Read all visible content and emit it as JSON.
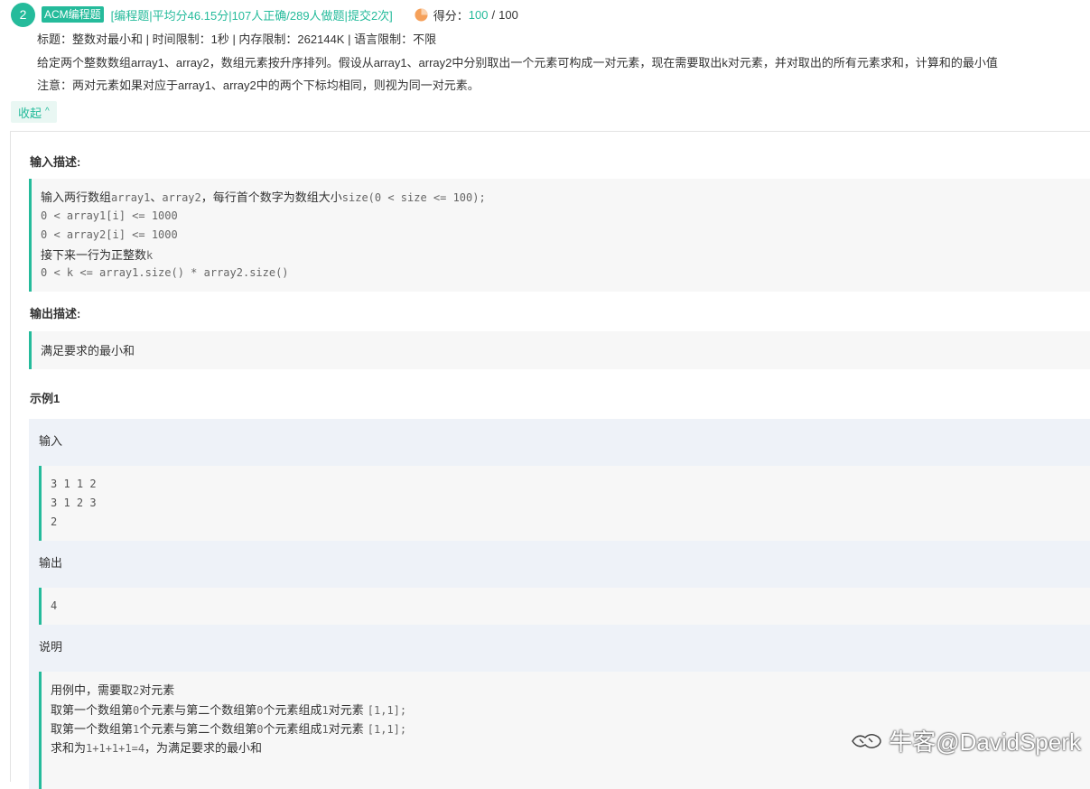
{
  "question": {
    "number": "2",
    "type_tag": "ACM编程题",
    "meta": "[编程题|平均分46.15分|107人正确/289人做题|提交2次]",
    "score_label": "得分：",
    "score_value": "100",
    "score_sep": "/",
    "score_total": "100",
    "title_line": "标题：整数对最小和 | 时间限制：1秒 | 内存限制：262144K | 语言限制：不限",
    "description": "给定两个整数数组array1、array2，数组元素按升序排列。假设从array1、array2中分别取出一个元素可构成一对元素，现在需要取出k对元素，并对取出的所有元素求和，计算和的最小值",
    "note": "注意：两对元素如果对应于array1、array2中的两个下标均相同，则视为同一对元素。",
    "collapse_label": "收起",
    "collapse_icon": "chevron-up-icon"
  },
  "input_desc": {
    "title": "输入描述:",
    "line1_cn": "输入两行数组",
    "line1_code1": "array1",
    "line1_cn2": "、",
    "line1_code2": "array2",
    "line1_cn3": "，每行首个数字为数组大小",
    "line1_code3": "size(0 < size <= 100);",
    "line2": "0 < array1[i] <= 1000",
    "line3": "0 < array2[i] <= 1000",
    "line4_cn": "接下来一行为正整数",
    "line4_code": "k",
    "line5": "0 < k <= array1.size() * array2.size()"
  },
  "output_desc": {
    "title": "输出描述:",
    "text": "满足要求的最小和"
  },
  "example": {
    "title": "示例1",
    "input_label": "输入",
    "input_lines": [
      "3 1 1 2",
      "3 1 2 3",
      "2"
    ],
    "output_label": "输出",
    "output_value": "4",
    "explain_label": "说明",
    "explain_line1_cn": "用例中，需要取",
    "explain_line1_code": "2",
    "explain_line1_cn2": "对元素",
    "explain_line2_cn": "取第一个数组第",
    "explain_line2_code": "0",
    "explain_line2_cn2": "个元素与第二个数组第",
    "explain_line2_code2": "0",
    "explain_line2_cn3": "个元素组成",
    "explain_line2_code3": "1",
    "explain_line2_cn4": "对元素",
    "explain_line2_code4": "[1,1];",
    "explain_line3_cn": "取第一个数组第",
    "explain_line3_code": "1",
    "explain_line3_cn2": "个元素与第二个数组第",
    "explain_line3_code2": "0",
    "explain_line3_cn3": "个元素组成",
    "explain_line3_code3": "1",
    "explain_line3_cn4": "对元素",
    "explain_line3_code4": "[1,1];",
    "explain_line4_cn": "求和为",
    "explain_line4_code": "1+1+1+1=4",
    "explain_line4_cn2": "，为满足要求的最小和"
  },
  "watermark": "牛客@DavidSperk",
  "colors": {
    "accent": "#25bb9b",
    "score_icon": "#f5a05a"
  }
}
